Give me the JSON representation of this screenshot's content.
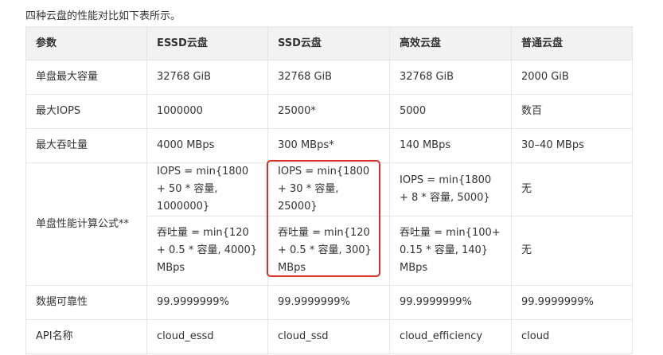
{
  "intro": "四种云盘的性能对比如下表所示。",
  "table": {
    "headers": [
      "参数",
      "ESSD云盘",
      "SSD云盘",
      "高效云盘",
      "普通云盘"
    ],
    "rows": [
      [
        "单盘最大容量",
        "32768 GiB",
        "32768 GiB",
        "32768 GiB",
        "2000 GiB"
      ],
      [
        "最大IOPS",
        "1000000",
        "25000*",
        "5000",
        "数百"
      ],
      [
        "最大吞吐量",
        "4000 MBps",
        "300 MBps*",
        "140 MBps",
        "30–40 MBps"
      ]
    ],
    "formula": {
      "label": "单盘性能计算公式**",
      "iops": [
        "IOPS = min{1800 + 50 * 容量, 1000000}",
        "IOPS = min{1800 + 30 * 容量, 25000}",
        "IOPS = min{1800 + 8 * 容量, 5000}",
        "无"
      ],
      "throughput": [
        "吞吐量 = min{120 + 0.5 * 容量, 4000} MBps",
        "吞吐量 = min{120 + 0.5 * 容量, 300} MBps",
        "吞吐量 = min{100+ 0.15 * 容量, 140} MBps",
        "无"
      ]
    },
    "rows_after": [
      [
        "数据可靠性",
        "99.9999999%",
        "99.9999999%",
        "99.9999999%",
        "99.9999999%"
      ],
      [
        "API名称",
        "cloud_essd",
        "cloud_ssd",
        "cloud_efficiency",
        "cloud"
      ]
    ]
  },
  "highlight": {
    "color": "#d93025"
  }
}
